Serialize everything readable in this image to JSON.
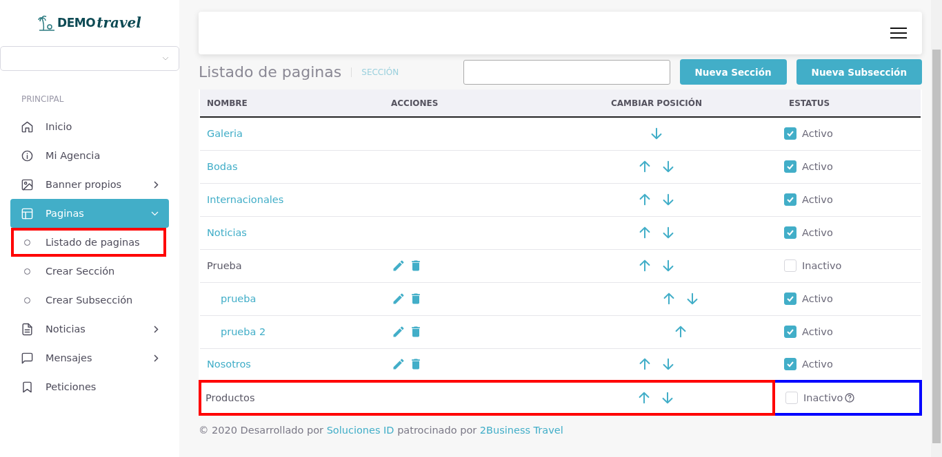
{
  "logo": {
    "text_main": "DEMO",
    "text_script": "travel"
  },
  "sidebar": {
    "section_label": "PRINCIPAL",
    "items": [
      {
        "label": "Inicio",
        "kind": "link",
        "selected": false
      },
      {
        "label": "Mi Agencia",
        "kind": "link",
        "selected": false
      },
      {
        "label": "Banner propios",
        "kind": "submenu",
        "expanded": false,
        "selected": false
      },
      {
        "label": "Paginas",
        "kind": "submenu",
        "expanded": true,
        "selected": true,
        "children": [
          {
            "label": "Listado de paginas",
            "highlighted": true
          },
          {
            "label": "Crear Sección",
            "highlighted": false
          },
          {
            "label": "Crear Subsección",
            "highlighted": false
          }
        ]
      },
      {
        "label": "Noticias",
        "kind": "submenu",
        "expanded": false,
        "selected": false
      },
      {
        "label": "Mensajes",
        "kind": "submenu",
        "expanded": false,
        "selected": false
      },
      {
        "label": "Peticiones",
        "kind": "link",
        "selected": false
      }
    ]
  },
  "page": {
    "title": "Listado de paginas",
    "subtitle": "SECCIÓN"
  },
  "toolbar": {
    "buttons": [
      "Nueva Sección",
      "Nueva Subsección"
    ]
  },
  "table": {
    "columns": [
      "NOMBRE",
      "ACCIONES",
      "CAMBIAR POSICIÓN",
      "ESTATUS"
    ],
    "rows": [
      {
        "name": "Galeria",
        "link": true,
        "actions": false,
        "up": false,
        "down": true,
        "checked": true,
        "status": "Activo",
        "highlighted": false,
        "status_highlighted": false
      },
      {
        "name": "Bodas",
        "link": true,
        "actions": false,
        "up": true,
        "down": true,
        "checked": true,
        "status": "Activo",
        "highlighted": false,
        "status_highlighted": false
      },
      {
        "name": "Internacionales",
        "link": true,
        "actions": false,
        "up": true,
        "down": true,
        "checked": true,
        "status": "Activo",
        "highlighted": false,
        "status_highlighted": false
      },
      {
        "name": "Noticias",
        "link": true,
        "actions": false,
        "up": true,
        "down": true,
        "checked": true,
        "status": "Activo",
        "highlighted": false,
        "status_highlighted": false
      },
      {
        "name": "Prueba",
        "link": false,
        "actions": true,
        "up": true,
        "down": true,
        "checked": false,
        "status": "Inactivo",
        "highlighted": false,
        "status_highlighted": false,
        "children": [
          {
            "name": "prueba",
            "link": true,
            "actions": true,
            "up": true,
            "down": true,
            "checked": true,
            "status": "Activo",
            "highlighted": false,
            "status_highlighted": false
          },
          {
            "name": "prueba 2",
            "link": true,
            "actions": true,
            "up": true,
            "down": false,
            "checked": true,
            "status": "Activo",
            "highlighted": false,
            "status_highlighted": false
          }
        ]
      },
      {
        "name": "Nosotros",
        "link": true,
        "actions": true,
        "up": true,
        "down": true,
        "checked": true,
        "status": "Activo",
        "highlighted": false,
        "status_highlighted": false
      },
      {
        "name": "Productos",
        "link": false,
        "actions": false,
        "up": true,
        "down": true,
        "checked": false,
        "status": "Inactivo",
        "help": true,
        "highlighted": true,
        "status_highlighted": true
      }
    ]
  },
  "footer": {
    "prefix": "© 2020 Desarrollado por",
    "link1": "Soluciones ID",
    "middle": "patrocinado por",
    "link2": "2Business Travel"
  }
}
